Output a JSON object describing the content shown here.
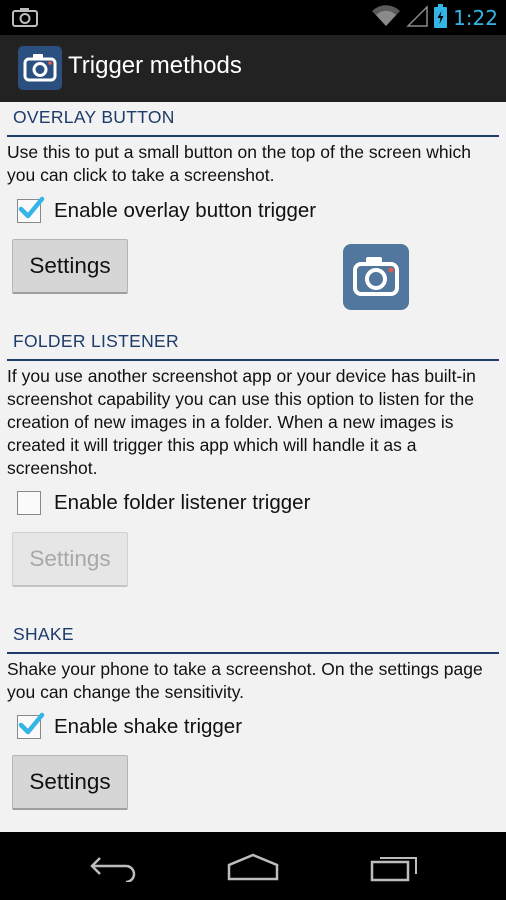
{
  "status_bar": {
    "time": "1:22",
    "icons": [
      "screenshot-notification-icon",
      "wifi-icon",
      "cell-signal-icon",
      "battery-charging-icon"
    ],
    "accent_color": "#33b5e5"
  },
  "action_bar": {
    "title": "Trigger methods",
    "icon": "camera-icon",
    "background": "#222222"
  },
  "sections": {
    "overlay": {
      "header": "OVERLAY BUTTON",
      "description": "Use this to put a small button on the top of the screen which you can click to take a screenshot.",
      "checkbox_label": "Enable overlay button trigger",
      "checked": true,
      "settings_label": "Settings",
      "settings_enabled": true,
      "preview_icon": "camera-icon"
    },
    "folder": {
      "header": "FOLDER LISTENER",
      "description": "If you use another screenshot app or your device has built-in screenshot capability you can use this option to listen for the creation of new images in a folder. When a new images is created it will trigger this app which will handle it as a screenshot.",
      "checkbox_label": "Enable folder listener trigger",
      "checked": false,
      "settings_label": "Settings",
      "settings_enabled": false
    },
    "shake": {
      "header": "SHAKE",
      "description": "Shake your phone to take a screenshot. On the settings page you can change the sensitivity.",
      "checkbox_label": "Enable shake trigger",
      "checked": true,
      "settings_label": "Settings",
      "settings_enabled": true
    }
  },
  "nav_bar": {
    "icons": [
      "back-icon",
      "home-icon",
      "recent-apps-icon"
    ]
  },
  "colors": {
    "section_header": "#1d3b6b",
    "check_accent": "#33b5e5"
  }
}
